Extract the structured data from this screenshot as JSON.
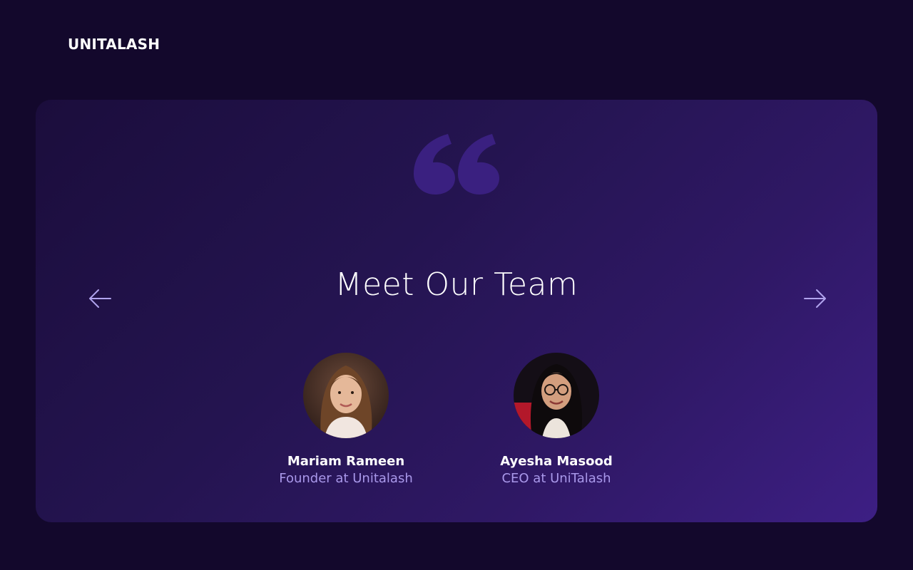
{
  "brand": {
    "name": "UNITALASH"
  },
  "section": {
    "title": "Meet Our Team",
    "prev_icon": "arrow-left-icon",
    "next_icon": "arrow-right-icon",
    "quote_icon": "quote-icon"
  },
  "team": [
    {
      "name": "Mariam Rameen",
      "role": "Founder at Unitalash"
    },
    {
      "name": "Ayesha Masood",
      "role": "CEO at UniTalash"
    }
  ],
  "colors": {
    "background": "#13082c",
    "accent": "#a998ea",
    "quote": "#3a2080"
  }
}
